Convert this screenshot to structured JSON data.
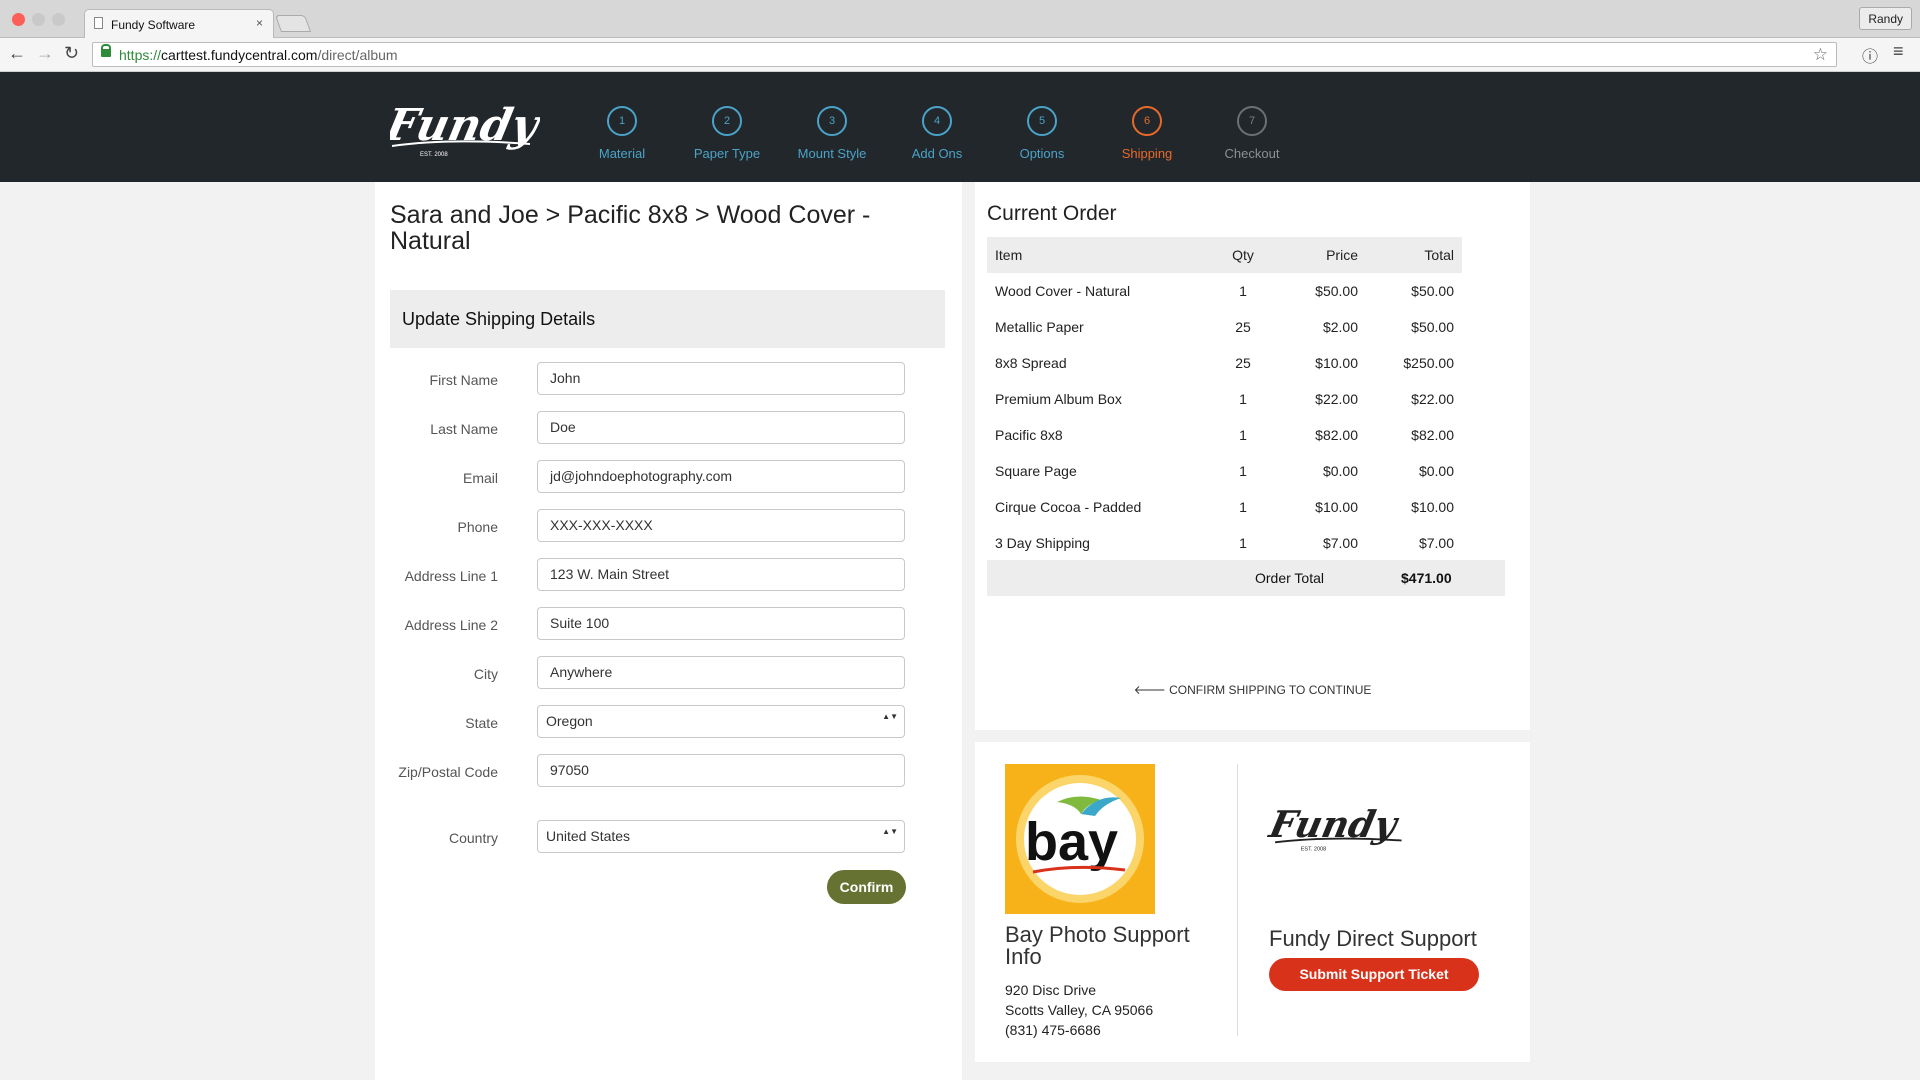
{
  "browser": {
    "tab_title": "Fundy Software",
    "tab_close": "×",
    "profile": "Randy",
    "url_scheme": "https://",
    "url_domain": "carttest.fundycentral.com",
    "url_path": "/direct/album",
    "back": "←",
    "forward": "→",
    "reload": "↻",
    "star": "☆",
    "info": "ⓘ",
    "menu": "≡"
  },
  "header": {
    "steps": [
      {
        "num": "1",
        "label": "Material"
      },
      {
        "num": "2",
        "label": "Paper Type"
      },
      {
        "num": "3",
        "label": "Mount Style"
      },
      {
        "num": "4",
        "label": "Add Ons"
      },
      {
        "num": "5",
        "label": "Options"
      },
      {
        "num": "6",
        "label": "Shipping"
      },
      {
        "num": "7",
        "label": "Checkout"
      }
    ],
    "logo_text": "Fundy",
    "logo_est": "EST. 2008"
  },
  "breadcrumb": "Sara and Joe > Pacific 8x8 > Wood Cover - Natural",
  "form": {
    "heading": "Update Shipping Details",
    "fields": [
      {
        "label": "First Name",
        "value": "John"
      },
      {
        "label": "Last Name",
        "value": "Doe"
      },
      {
        "label": "Email",
        "value": "jd@johndoephotography.com"
      },
      {
        "label": "Phone",
        "value": "XXX-XXX-XXXX"
      },
      {
        "label": "Address Line 1",
        "value": "123 W. Main Street"
      },
      {
        "label": "Address Line 2",
        "value": "Suite 100"
      },
      {
        "label": "City",
        "value": "Anywhere"
      },
      {
        "label": "State",
        "value": "Oregon"
      },
      {
        "label": "Zip/Postal Code",
        "value": "97050"
      },
      {
        "label": "Country",
        "value": "United States"
      }
    ],
    "arrows": "▲▼",
    "confirm_label": "Confirm"
  },
  "order": {
    "title": "Current Order",
    "columns": [
      "Item",
      "Qty",
      "Price",
      "Total"
    ],
    "rows": [
      [
        "Wood Cover - Natural",
        "1",
        "$50.00",
        "$50.00"
      ],
      [
        "Metallic Paper",
        "25",
        "$2.00",
        "$50.00"
      ],
      [
        "8x8 Spread",
        "25",
        "$10.00",
        "$250.00"
      ],
      [
        "Premium Album Box",
        "1",
        "$22.00",
        "$22.00"
      ],
      [
        "Pacific 8x8",
        "1",
        "$82.00",
        "$82.00"
      ],
      [
        "Square Page",
        "1",
        "$0.00",
        "$0.00"
      ],
      [
        "Cirque Cocoa - Padded",
        "1",
        "$10.00",
        "$10.00"
      ],
      [
        "3 Day Shipping",
        "1",
        "$7.00",
        "$7.00"
      ]
    ],
    "total_label": "Order Total",
    "total_value": "$471.00",
    "continue_message": "🡐 CONFIRM SHIPPING TO CONTINUE"
  },
  "support": {
    "bay_logo_text": "bay",
    "bay_title": "Bay Photo Support Info",
    "bay_address": [
      "920 Disc Drive",
      "Scotts Valley, CA 95066",
      "(831) 475-6686"
    ],
    "fundy_title": "Fundy Direct Support",
    "ticket_label": "Submit Support Ticket"
  },
  "colors": {
    "header_bg": "#22272b",
    "step_blue": "#4aa3c8",
    "step_active": "#e86a2a",
    "confirm_green": "#667232",
    "ticket_red": "#d9321a"
  }
}
